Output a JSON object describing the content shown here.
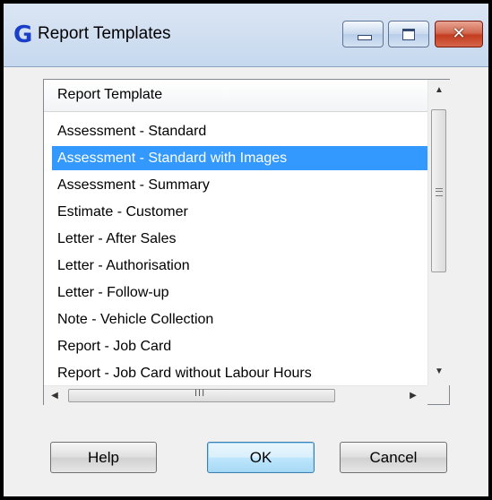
{
  "window": {
    "title": "Report Templates",
    "app_icon_glyph": "G",
    "controls": {
      "minimize": "minimize-icon",
      "maximize": "maximize-icon",
      "close": "close-icon",
      "close_glyph": "✕"
    }
  },
  "list": {
    "column_header": "Report Template",
    "selected_index": 1,
    "items": [
      "Assessment - Standard",
      "Assessment - Standard with Images",
      "Assessment - Summary",
      "Estimate - Customer",
      "Letter - After Sales",
      "Letter - Authorisation",
      "Letter - Follow-up",
      "Note - Vehicle Collection",
      "Report - Job Card",
      "Report - Job Card without Labour Hours"
    ]
  },
  "buttons": {
    "help": "Help",
    "ok": "OK",
    "cancel": "Cancel"
  },
  "colors": {
    "selection": "#3399ff",
    "close_button": "#c43d20"
  }
}
